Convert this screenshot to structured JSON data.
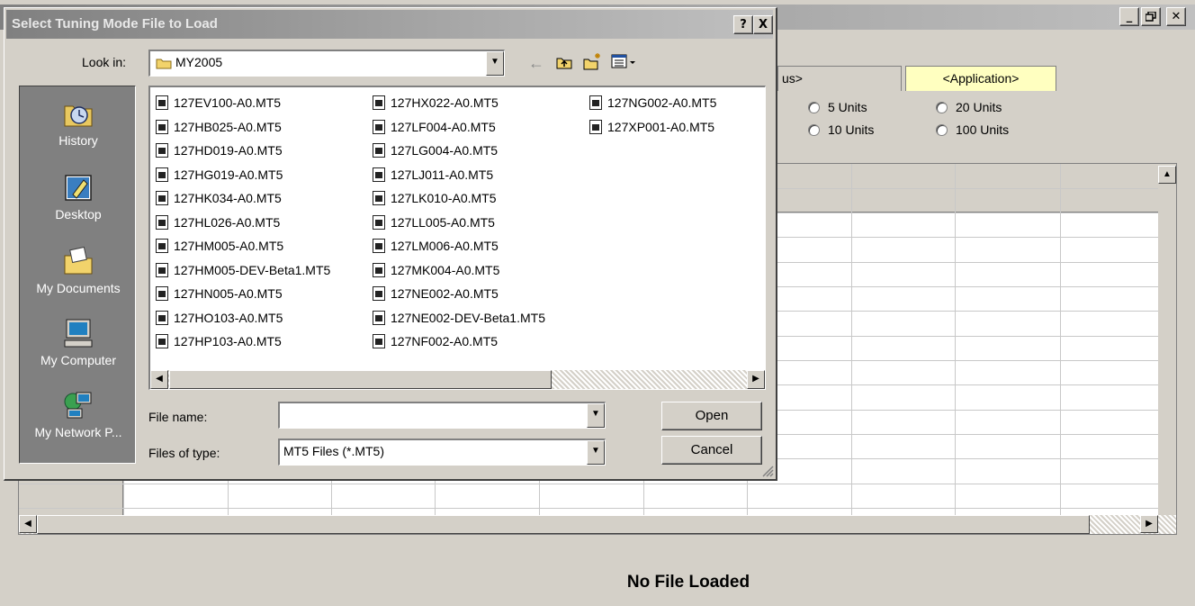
{
  "background_app": {
    "window_buttons": [
      "_",
      "B",
      "X"
    ],
    "tab_partial_label": "us>",
    "tab_application_label": "<Application>",
    "radio_options": [
      "5 Units",
      "10 Units",
      "20 Units",
      "100 Units"
    ],
    "status_text": "No File Loaded"
  },
  "dialog": {
    "title": "Select Tuning Mode File to Load",
    "help_button": "?",
    "close_button": "X",
    "look_in_label": "Look in:",
    "look_in_value": "MY2005",
    "toolbar_icons": [
      "back-arrow-icon",
      "up-folder-icon",
      "new-folder-icon",
      "view-menu-icon"
    ],
    "places": [
      "History",
      "Desktop",
      "My Documents",
      "My Computer",
      "My Network P..."
    ],
    "files": {
      "column1": [
        "127EV100-A0.MT5",
        "127HB025-A0.MT5",
        "127HD019-A0.MT5",
        "127HG019-A0.MT5",
        "127HK034-A0.MT5",
        "127HL026-A0.MT5",
        "127HM005-A0.MT5",
        "127HM005-DEV-Beta1.MT5",
        "127HN005-A0.MT5",
        "127HO103-A0.MT5",
        "127HP103-A0.MT5"
      ],
      "column2": [
        "127HX022-A0.MT5",
        "127LF004-A0.MT5",
        "127LG004-A0.MT5",
        "127LJ011-A0.MT5",
        "127LK010-A0.MT5",
        "127LL005-A0.MT5",
        "127LM006-A0.MT5",
        "127MK004-A0.MT5",
        "127NE002-A0.MT5",
        "127NE002-DEV-Beta1.MT5",
        "127NF002-A0.MT5"
      ],
      "column3": [
        "127NG002-A0.MT5",
        "127XP001-A0.MT5"
      ]
    },
    "file_name_label": "File name:",
    "file_name_value": "",
    "file_type_label": "Files of type:",
    "file_type_value": "MT5 Files (*.MT5)",
    "open_button": "Open",
    "cancel_button": "Cancel"
  }
}
